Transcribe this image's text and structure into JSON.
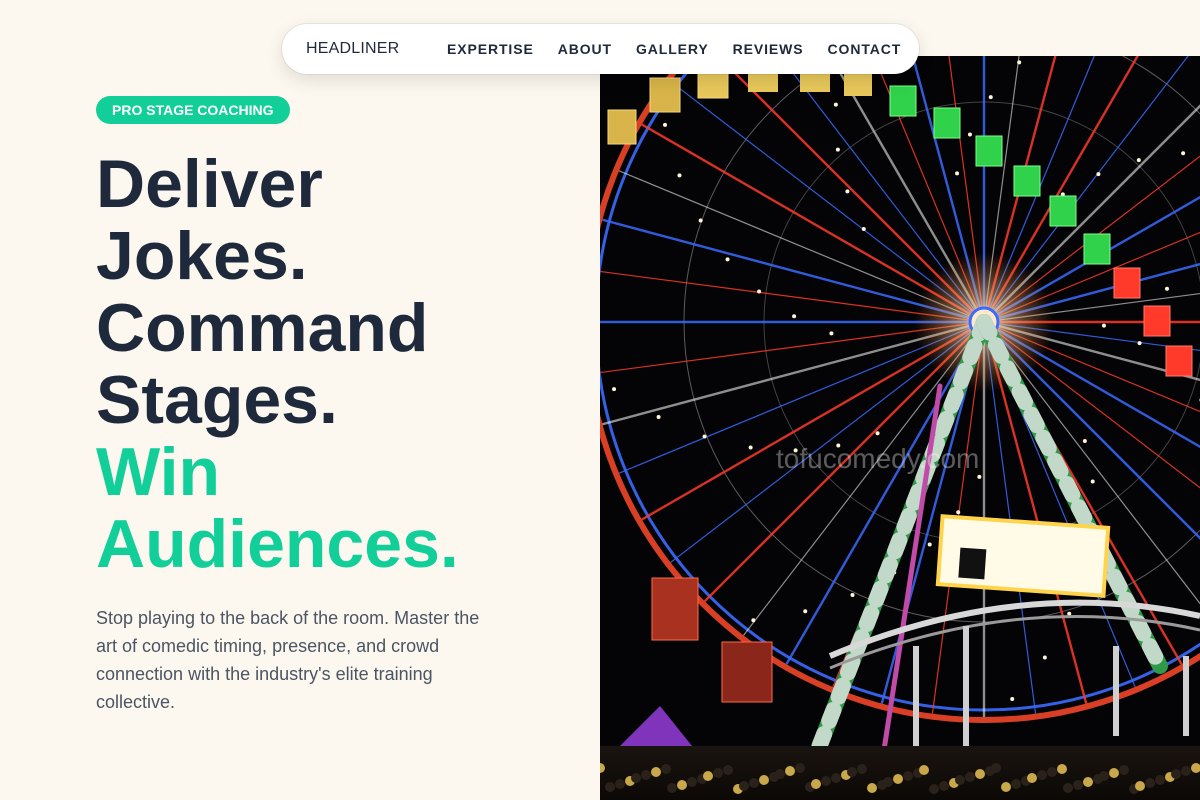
{
  "nav": {
    "brand": "HEADLINER",
    "links": [
      "EXPERTISE",
      "ABOUT",
      "GALLERY",
      "REVIEWS",
      "CONTACT"
    ]
  },
  "hero": {
    "badge": "PRO STAGE COACHING",
    "headline_lines": [
      "Deliver",
      "Jokes.",
      "Command",
      "Stages."
    ],
    "headline_accent_lines": [
      "Win",
      "Audiences."
    ],
    "description": "Stop playing to the back of the room. Master the art of comedic timing, presence, and crowd connection with the industry's elite training collective.",
    "image_watermark": "tofucomedy.com"
  },
  "colors": {
    "accent": "#12cf9a",
    "text_dark": "#1e293b",
    "background": "#fdf8ef"
  }
}
